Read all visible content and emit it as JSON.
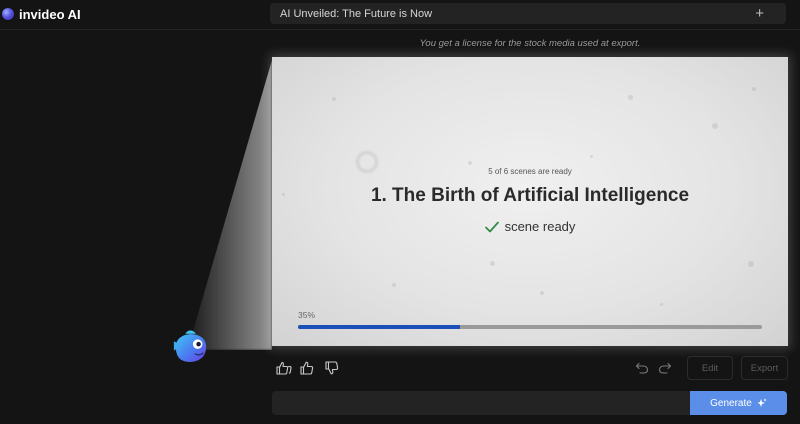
{
  "app": {
    "name": "invideo AI"
  },
  "header": {
    "project_title": "AI Unveiled: The Future is Now",
    "add_icon": "plus-icon"
  },
  "license_note": "You get a license for the stock media used at export.",
  "preview": {
    "status_text": "5 of 6 scenes are ready",
    "scenes_ready": 5,
    "scenes_total": 6,
    "scene_title": "1. The Birth of Artificial Intelligence",
    "ready_label": "scene ready",
    "progress_label": "35%",
    "progress_fraction": 0.35
  },
  "toolbar": {
    "feedback_icons": [
      "thumbs-up-double-icon",
      "thumbs-up-icon",
      "thumbs-down-icon"
    ],
    "undo_icon": "undo-icon",
    "redo_icon": "redo-icon",
    "edit_label": "Edit",
    "export_label": "Export"
  },
  "prompt": {
    "value": "",
    "generate_label": "Generate",
    "generate_icon": "sparkle-icon"
  },
  "colors": {
    "accent": "#5a8ee8",
    "progress": "#1d4fb8",
    "check": "#2e8a43",
    "background": "#141414"
  }
}
